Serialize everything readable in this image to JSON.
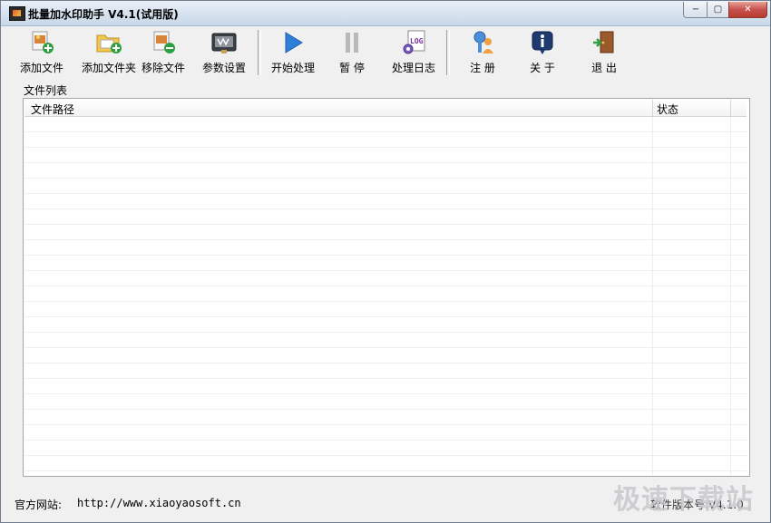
{
  "window": {
    "title": "批量加水印助手 V4.1(试用版)",
    "controls": {
      "minimize": "−",
      "maximize": "▢",
      "close": "✕"
    }
  },
  "toolbar": {
    "buttons": [
      {
        "label": "添加文件",
        "icon": "add-file-icon"
      },
      {
        "label": "添加文件夹",
        "icon": "add-folder-icon"
      },
      {
        "label": "移除文件",
        "icon": "remove-file-icon"
      },
      {
        "label": "参数设置",
        "icon": "settings-icon"
      },
      {
        "label": "开始处理",
        "icon": "play-icon"
      },
      {
        "label": "暂 停",
        "icon": "pause-icon"
      },
      {
        "label": "处理日志",
        "icon": "log-icon"
      },
      {
        "label": "注 册",
        "icon": "register-key-icon"
      },
      {
        "label": "关 于",
        "icon": "info-icon"
      },
      {
        "label": "退 出",
        "icon": "exit-door-icon"
      }
    ]
  },
  "file_list": {
    "group_label": "文件列表",
    "columns": [
      "文件路径",
      "状态"
    ],
    "rows": []
  },
  "status": {
    "site_label": "官方网站:",
    "site_url": "http://www.xiaoyaosoft.cn",
    "version": "软件版本号:V4.1.0"
  },
  "watermark": {
    "text": "极速下载站"
  },
  "colors": {
    "accent_blue": "#2f7fd8",
    "close_red": "#c75050"
  }
}
